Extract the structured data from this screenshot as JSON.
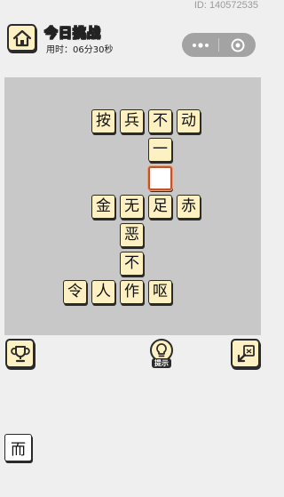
{
  "header": {
    "user_id": "ID: 140572535",
    "title": "今日挑战",
    "timer": "用时：06分30秒"
  },
  "board": {
    "tiles": [
      {
        "char": "按"
      },
      {
        "char": "兵"
      },
      {
        "char": "不"
      },
      {
        "char": "动"
      },
      {
        "char": "一"
      },
      {
        "char": ""
      },
      {
        "char": "金"
      },
      {
        "char": "无"
      },
      {
        "char": "足"
      },
      {
        "char": "赤"
      },
      {
        "char": "恶"
      },
      {
        "char": "不"
      },
      {
        "char": "令"
      },
      {
        "char": "人"
      },
      {
        "char": "作"
      },
      {
        "char": "呕"
      }
    ]
  },
  "controls": {
    "hint_label": "提示"
  },
  "candidates": [
    {
      "char": "而"
    }
  ]
}
